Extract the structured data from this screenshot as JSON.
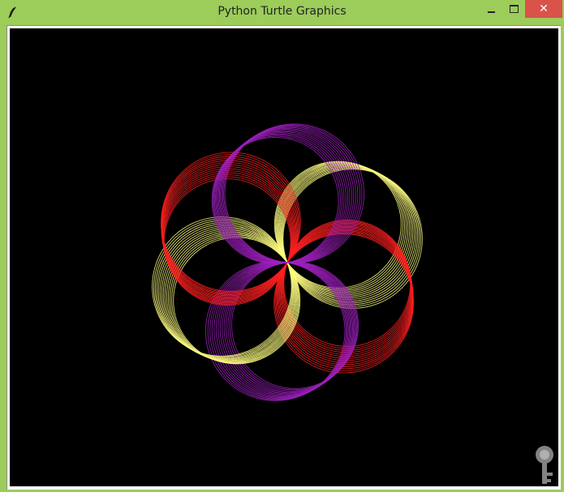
{
  "window": {
    "title": "Python Turtle Graphics",
    "app_icon": "feather-icon"
  },
  "controls": {
    "minimize_icon": "minimize-icon",
    "maximize_icon": "maximize-icon",
    "close_icon": "close-icon",
    "close_glyph": "✕"
  },
  "canvas": {
    "background": "#000000",
    "drawing": "spirograph-flower",
    "petal_colors": [
      "#ffff80",
      "#ff2020",
      "#a020c0",
      "#ffff80",
      "#ff2020",
      "#a020c0"
    ],
    "petals": 6,
    "circles_per_petal": 14
  },
  "colors": {
    "titlebar": "#9ccc5a",
    "close_button": "#d9534a"
  },
  "watermark": {
    "icon": "key-watermark-icon"
  }
}
